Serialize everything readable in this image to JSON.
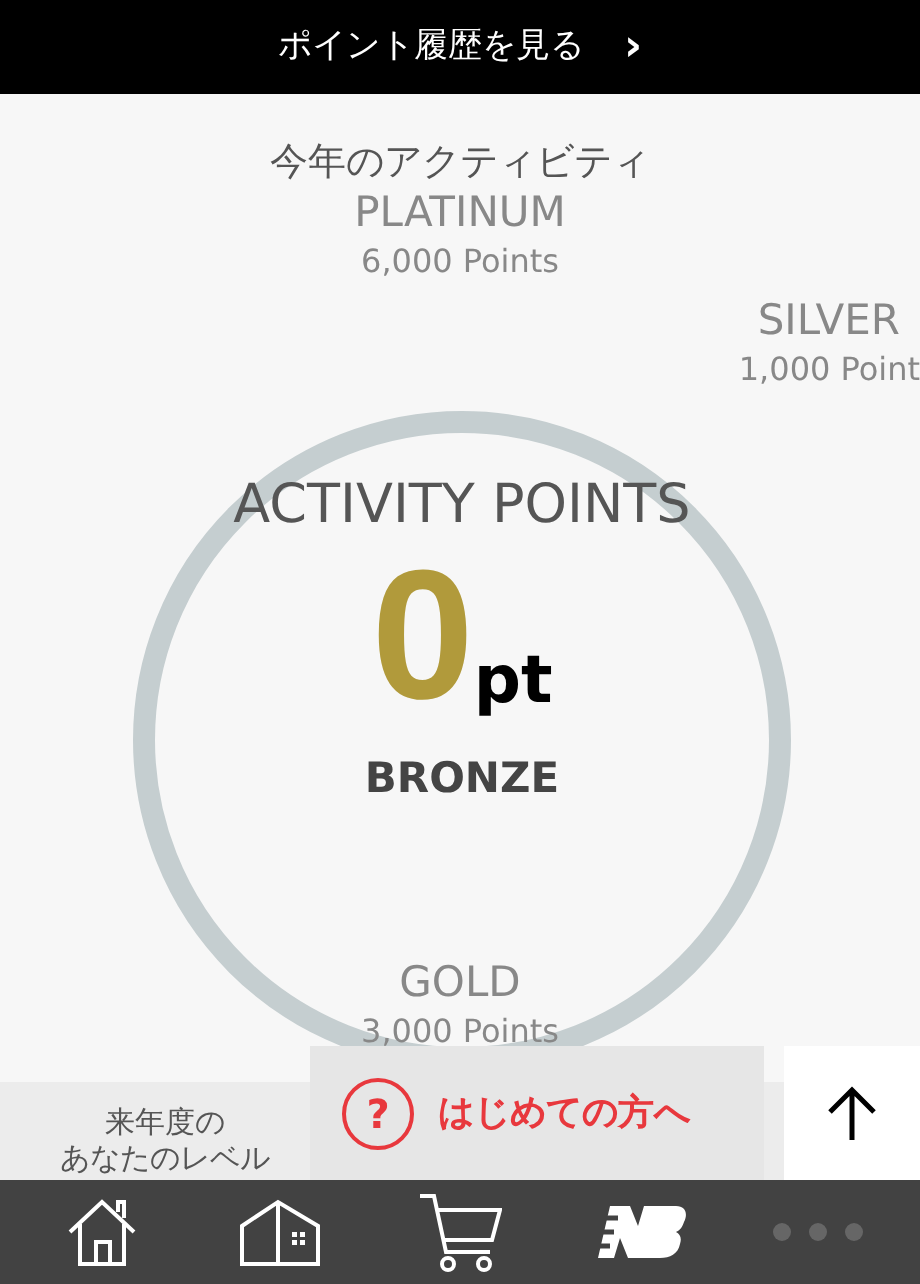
{
  "top_bar": {
    "label": "ポイント履歴を見る",
    "chevron": "›"
  },
  "activity": {
    "title": "今年のアクティビティ",
    "tiers": [
      {
        "name": "PLATINUM",
        "points": "6,000 Points"
      },
      {
        "name": "SILVER",
        "points": "1,000 Point"
      },
      {
        "name": "GOLD",
        "points": "3,000 Points"
      }
    ],
    "heading": "ACTIVITY POINTS",
    "value": "0",
    "unit": "pt",
    "level": "BRONZE"
  },
  "next_year": {
    "lines": [
      "来年度の",
      "あなたのレベル"
    ]
  },
  "help_button": {
    "icon": "?",
    "label": "はじめての方へ"
  },
  "nav": {
    "items": [
      {
        "kind": "home"
      },
      {
        "kind": "store"
      },
      {
        "kind": "cart"
      },
      {
        "kind": "logo"
      },
      {
        "kind": "more"
      }
    ]
  }
}
